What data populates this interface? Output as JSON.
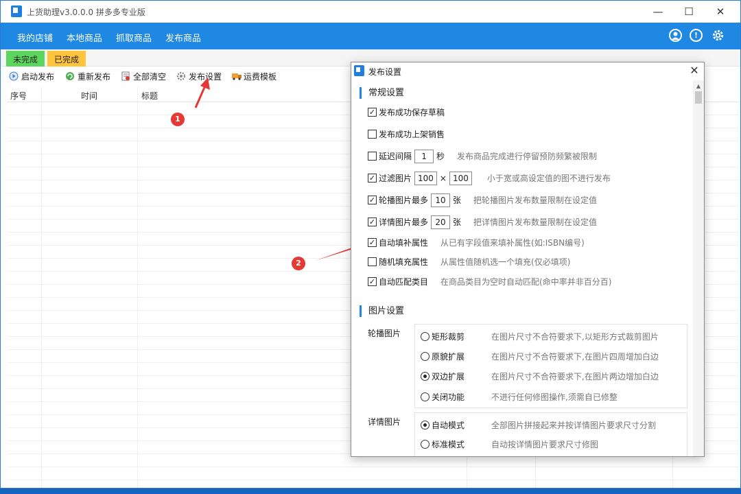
{
  "app": {
    "title": "上货助理v3.0.0.0 拼多多专业版",
    "window_controls": {
      "minimize": "—",
      "maximize": "☐",
      "close": "✕"
    }
  },
  "menubar": {
    "items": [
      "我的店铺",
      "本地商品",
      "抓取商品",
      "发布商品"
    ],
    "icons": [
      "user-icon",
      "info-icon",
      "gear-icon"
    ]
  },
  "tabs": [
    {
      "label": "未完成",
      "color": "#5cd65c"
    },
    {
      "label": "已完成",
      "color": "#ffc43d"
    }
  ],
  "toolbar": [
    {
      "label": "启动发布",
      "icon": "play-icon"
    },
    {
      "label": "重新发布",
      "icon": "refresh-icon"
    },
    {
      "label": "全部清空",
      "icon": "clear-icon"
    },
    {
      "label": "发布设置",
      "icon": "gear-icon"
    },
    {
      "label": "运费模板",
      "icon": "truck-icon"
    }
  ],
  "table": {
    "columns": [
      "序号",
      "时间",
      "标题"
    ]
  },
  "annotations": {
    "one": "1",
    "two": "2",
    "accent": "#e53935"
  },
  "dialog": {
    "title": "发布设置",
    "close": "✕",
    "sections": {
      "general": "常规设置",
      "image": "图片设置"
    },
    "options": {
      "save_draft": {
        "label": "发布成功保存草稿",
        "checked": true
      },
      "list_sale": {
        "label": "发布成功上架销售",
        "checked": false
      },
      "delay": {
        "label": "延迟间隔",
        "checked": false,
        "value": "1",
        "unit": "秒",
        "hint": "发布商品完成进行停留预防频繁被限制"
      },
      "filter": {
        "label": "过滤图片",
        "checked": true,
        "w": "100",
        "x": "×",
        "h": "100",
        "hint": "小于宽或高设定值的图不进行发布"
      },
      "carousel_max": {
        "label": "轮播图片最多",
        "checked": true,
        "value": "10",
        "unit": "张",
        "hint": "把轮播图片发布数量限制在设定值"
      },
      "detail_max": {
        "label": "详情图片最多",
        "checked": true,
        "value": "20",
        "unit": "张",
        "hint": "把详情图片发布数量限制在设定值"
      },
      "auto_fill": {
        "label": "自动填补属性",
        "checked": true,
        "hint": "从已有字段值来填补属性(如:ISBN编号)"
      },
      "random_fill": {
        "label": "随机填充属性",
        "checked": false,
        "hint": "从属性值随机选一个填充(仅必填项)"
      },
      "auto_cat": {
        "label": "自动匹配类目",
        "checked": true,
        "hint": "在商品类目为空时自动匹配(命中率并非百分百)"
      }
    },
    "carousel": {
      "label": "轮播图片",
      "options": [
        {
          "label": "矩形裁剪",
          "hint": "在图片尺寸不合符要求下,以矩形方式裁剪图片",
          "selected": false
        },
        {
          "label": "原貌扩展",
          "hint": "在图片尺寸不合符要求下,在图片四周增加白边",
          "selected": false
        },
        {
          "label": "双边扩展",
          "hint": "在图片尺寸不合符要求下,在图片两边增加白边",
          "selected": true
        },
        {
          "label": "关闭功能",
          "hint": "不进行任何修图操作,须需自已修整",
          "selected": false
        }
      ]
    },
    "detail": {
      "label": "详情图片",
      "options": [
        {
          "label": "自动模式",
          "hint": "全部图片拼接起来并按详情图片要求尺寸分割",
          "selected": true
        },
        {
          "label": "标准模式",
          "hint": "自动按详情图片要求尺寸修图",
          "selected": false
        }
      ]
    }
  }
}
